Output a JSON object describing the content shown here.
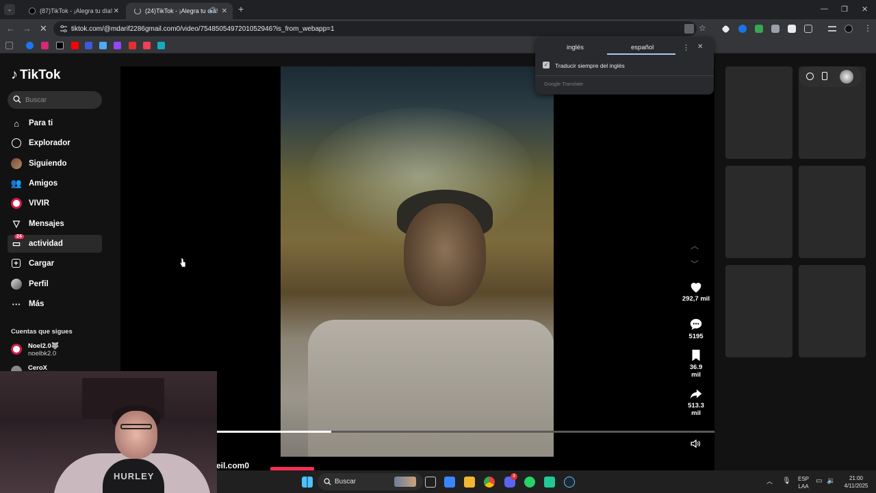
{
  "browser": {
    "tabs": [
      {
        "title": "(87)TikTok - ¡Alegra tu día!",
        "active": false
      },
      {
        "title": "(24)TikTok - ¡Alegra tu día!",
        "active": true
      }
    ],
    "new_tab_label": "+",
    "url": "tiktok.com/@mdarif2286gmail.com0/video/7548505497201052946?is_from_webapp=1"
  },
  "translate_popup": {
    "source_lang": "inglés",
    "target_lang": "español",
    "always_translate": "Traducir siempre del inglés",
    "footer": "Google Translate"
  },
  "tiktok": {
    "logo": "TikTok",
    "search_placeholder": "Buscar",
    "nav": [
      {
        "label": "Para ti",
        "icon": "home-icon"
      },
      {
        "label": "Explorador",
        "icon": "compass-icon"
      },
      {
        "label": "Siguiendo",
        "icon": "avatar-icon"
      },
      {
        "label": "Amigos",
        "icon": "friends-icon"
      },
      {
        "label": "VIVIR",
        "icon": "live-icon"
      },
      {
        "label": "Mensajes",
        "icon": "send-icon"
      },
      {
        "label": "actividad",
        "icon": "inbox-icon",
        "badge": "24"
      },
      {
        "label": "Cargar",
        "icon": "upload-icon"
      },
      {
        "label": "Perfil",
        "icon": "profile-icon"
      },
      {
        "label": "Más",
        "icon": "more-icon"
      }
    ],
    "following_title": "Cuentas que sigues",
    "following": [
      {
        "name": "Noel2.0🐺",
        "handle": "noelbk2.0"
      },
      {
        "name": "CeroX",
        "handle": ""
      }
    ],
    "video": {
      "author_partial": "eil.com0",
      "progress": 0.23
    },
    "actions": {
      "likes": "292,7 mil",
      "comments": "5195",
      "saves": "36.9 mil",
      "shares": "513.3 mil"
    }
  },
  "webcam_overlay": {
    "shirt_text": "HURLEY"
  },
  "taskbar": {
    "search_placeholder": "Buscar",
    "discord_badge": "3",
    "lang_top": "ESP",
    "lang_bottom": "LAA",
    "time": "21:00",
    "date": "4/11/2025"
  }
}
